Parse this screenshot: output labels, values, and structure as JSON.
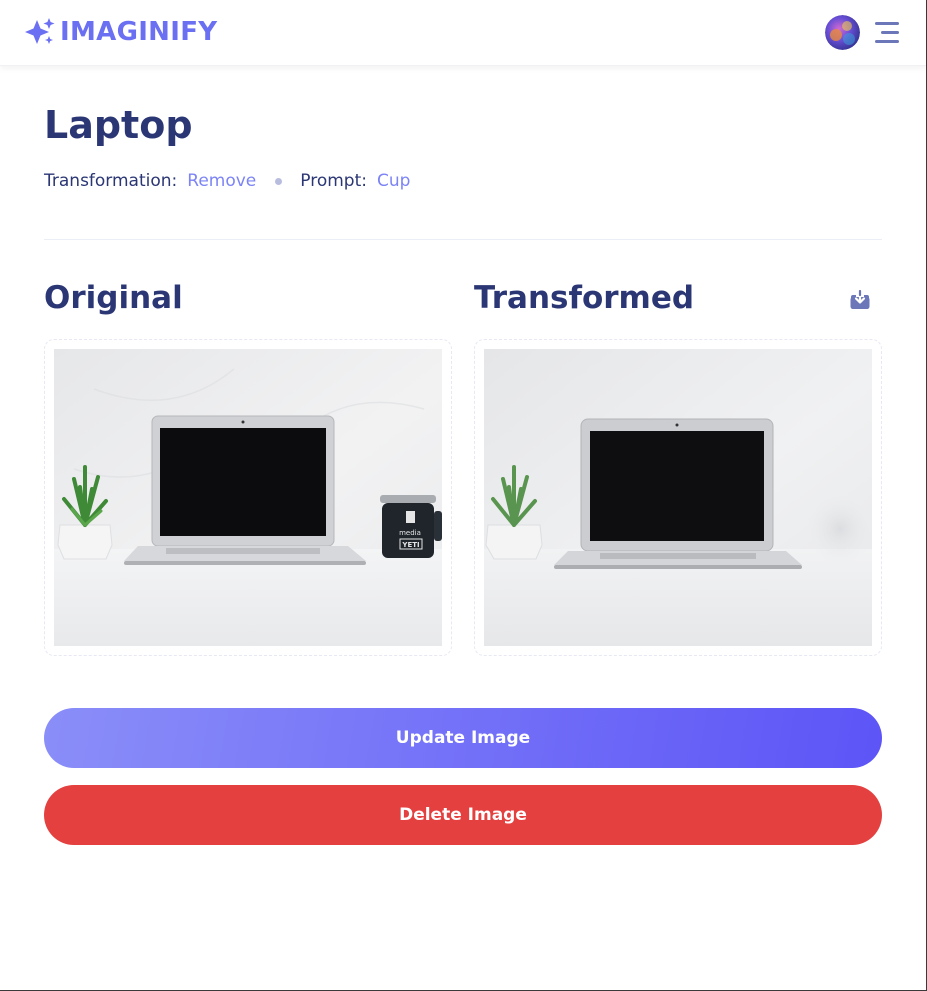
{
  "brand": {
    "name": "IMAGINIFY",
    "color": "#6b6ff2"
  },
  "header": {
    "avatar_icon": "user-avatar",
    "menu_icon": "hamburger-menu-icon"
  },
  "image": {
    "title": "Laptop",
    "transformation_label": "Transformation:",
    "transformation_value": "Remove",
    "prompt_label": "Prompt:",
    "prompt_value": "Cup"
  },
  "sections": {
    "original_title": "Original",
    "transformed_title": "Transformed",
    "download_icon": "download-icon"
  },
  "original_image": {
    "mug_text": "media",
    "mug_brand": "YETI"
  },
  "actions": {
    "update_label": "Update Image",
    "delete_label": "Delete Image"
  },
  "colors": {
    "title": "#2b3674",
    "accent": "#7c84f5",
    "delete": "#e44040",
    "update_start": "#8a8ef8",
    "update_end": "#5d54f7"
  }
}
